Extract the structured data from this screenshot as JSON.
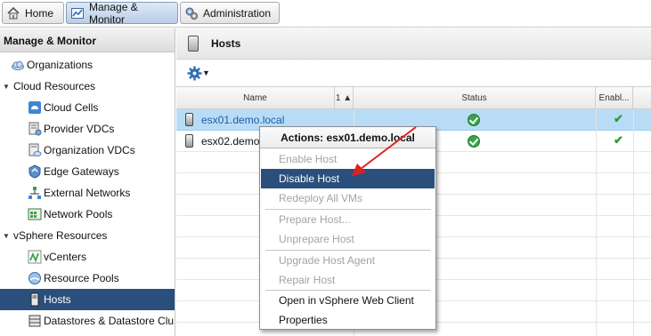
{
  "tabs": [
    {
      "label": "Home",
      "icon": "home-icon"
    },
    {
      "label": "Manage & Monitor",
      "icon": "manage-monitor-icon"
    },
    {
      "label": "Administration",
      "icon": "administration-gear-icon"
    }
  ],
  "sidebar": {
    "header": "Manage & Monitor",
    "items": [
      {
        "label": "Organizations",
        "icon": "organizations-cloud-icon",
        "level": 1
      },
      {
        "label": "Cloud Resources",
        "icon": "",
        "level": 0,
        "expanded": true
      },
      {
        "label": "Cloud Cells",
        "icon": "cloud-cells-icon",
        "level": 2
      },
      {
        "label": "Provider VDCs",
        "icon": "provider-vdcs-icon",
        "level": 2
      },
      {
        "label": "Organization VDCs",
        "icon": "organization-vdcs-icon",
        "level": 2
      },
      {
        "label": "Edge Gateways",
        "icon": "edge-gateways-icon",
        "level": 2
      },
      {
        "label": "External Networks",
        "icon": "external-networks-icon",
        "level": 2
      },
      {
        "label": "Network Pools",
        "icon": "network-pools-icon",
        "level": 2
      },
      {
        "label": "vSphere Resources",
        "icon": "",
        "level": 0,
        "expanded": true
      },
      {
        "label": "vCenters",
        "icon": "vcenters-icon",
        "level": 2
      },
      {
        "label": "Resource Pools",
        "icon": "resource-pools-icon",
        "level": 2
      },
      {
        "label": "Hosts",
        "icon": "hosts-icon",
        "level": 2,
        "selected": true
      },
      {
        "label": "Datastores & Datastore Clu",
        "icon": "datastores-icon",
        "level": 2
      }
    ]
  },
  "main": {
    "title": "Hosts",
    "columns": [
      {
        "label": "Name"
      },
      {
        "label": "1 ▲"
      },
      {
        "label": "Status"
      },
      {
        "label": "Enabl..."
      }
    ],
    "rows": [
      {
        "name": "esx01.demo.local",
        "status": "ok",
        "enabled": true,
        "selected": true
      },
      {
        "name": "esx02.demo.local",
        "status": "ok",
        "enabled": true,
        "selected": false
      }
    ]
  },
  "context_menu": {
    "title": "Actions: esx01.demo.local",
    "items": [
      {
        "label": "Enable Host",
        "disabled": true
      },
      {
        "label": "Disable Host",
        "highlighted": true
      },
      {
        "label": "Redeploy All VMs",
        "disabled": true
      },
      {
        "label": "Prepare Host...",
        "disabled": true
      },
      {
        "label": "Unprepare Host",
        "disabled": true
      },
      {
        "label": "Upgrade Host Agent",
        "disabled": true
      },
      {
        "label": "Repair Host",
        "disabled": true
      },
      {
        "label": "Open in vSphere Web Client",
        "disabled": false
      },
      {
        "label": "Properties",
        "disabled": false
      }
    ]
  },
  "colors": {
    "selection_dark": "#2b4f7c",
    "row_selected": "#b9dcf6",
    "ok_green": "#3aa34a",
    "annotation_arrow": "#e02020"
  }
}
